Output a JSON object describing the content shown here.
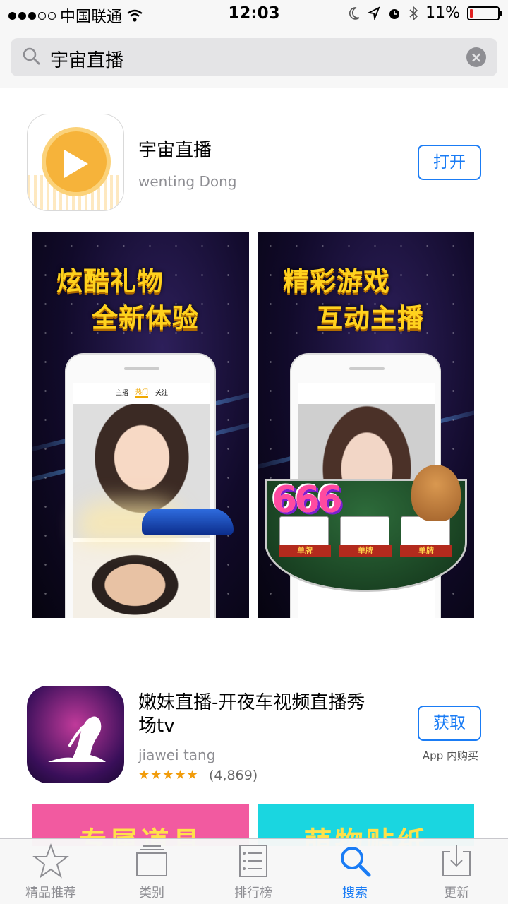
{
  "status_bar": {
    "carrier": "中国联通",
    "time": "12:03",
    "battery": "11%",
    "battery_level": 0.11
  },
  "search": {
    "query": "宇宙直播"
  },
  "apps": [
    {
      "name": "宇宙直播",
      "developer": "wenting Dong",
      "button": "打开",
      "screenshots": [
        {
          "line1": "炫酷礼物",
          "line2": "全新体验"
        },
        {
          "line1": "精彩游戏",
          "line2": "互动主播"
        }
      ]
    },
    {
      "name_line1": "嫩妹直播-开夜车视频直播秀",
      "name_line2": "场tv",
      "developer": "jiawei tang",
      "button": "获取",
      "in_app": "App 内购买",
      "stars": "★★★★★",
      "rating_count": "(4,869)",
      "rating": 5,
      "peek": [
        "专属道具",
        "萌物贴纸"
      ]
    }
  ],
  "tab_bar": {
    "items": [
      {
        "label": "精品推荐",
        "icon": "star-icon"
      },
      {
        "label": "类别",
        "icon": "stack-icon"
      },
      {
        "label": "排行榜",
        "icon": "list-icon"
      },
      {
        "label": "搜索",
        "icon": "search-icon",
        "active": true
      },
      {
        "label": "更新",
        "icon": "download-icon"
      }
    ]
  },
  "colors": {
    "accent": "#1a7cf5",
    "star": "#f19c0b",
    "battery_low": "#e02020"
  }
}
